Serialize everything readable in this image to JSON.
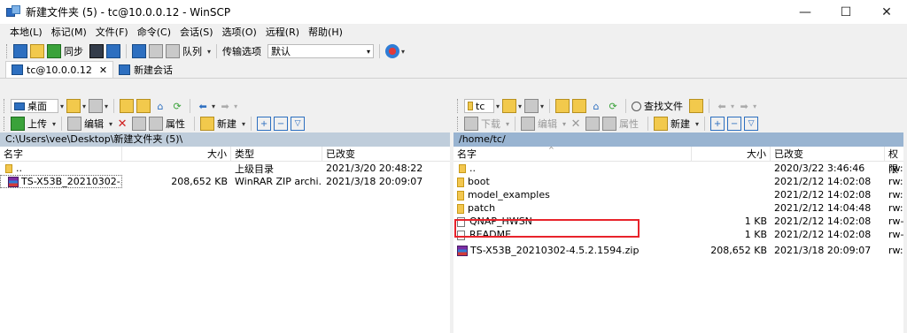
{
  "window": {
    "title": "新建文件夹 (5) - tc@10.0.0.12 - WinSCP",
    "minimize": "—",
    "maximize": "☐",
    "close": "✕"
  },
  "menu": [
    "本地(L)",
    "标记(M)",
    "文件(F)",
    "命令(C)",
    "会话(S)",
    "选项(O)",
    "远程(R)",
    "帮助(H)"
  ],
  "main_toolbar": {
    "sync_label": "同步",
    "queue_label": "队列",
    "transfer_label": "传输选项",
    "transfer_value": "默认"
  },
  "tabs": [
    {
      "label": "tc@10.0.0.12",
      "close": "✕"
    },
    {
      "label": "新建会话"
    }
  ],
  "left_panel": {
    "location": "桌面",
    "actions": {
      "upload": "上传",
      "edit": "编辑",
      "properties": "属性",
      "new": "新建"
    },
    "path": "C:\\Users\\vee\\Desktop\\新建文件夹 (5)\\",
    "columns": {
      "name": "名字",
      "size": "大小",
      "type": "类型",
      "modified": "已改变"
    },
    "rows": [
      {
        "name": "..",
        "size": "",
        "type": "上级目录",
        "modified": "2021/3/20  20:48:22",
        "icon": "parent-dir"
      },
      {
        "name": "TS-X53B_20210302-...",
        "size": "208,652 KB",
        "type": "WinRAR ZIP archi...",
        "modified": "2021/3/18  20:09:07",
        "icon": "rar-archive"
      }
    ]
  },
  "right_panel": {
    "location": "tc",
    "find_label": "查找文件",
    "actions": {
      "download": "下载",
      "edit": "编辑",
      "properties": "属性",
      "new": "新建"
    },
    "path": "/home/tc/",
    "columns": {
      "name": "名字",
      "size": "大小",
      "modified": "已改变",
      "rights": "权限"
    },
    "rows": [
      {
        "name": "..",
        "size": "",
        "modified": "2020/3/22 3:46:46",
        "rights": "rw:",
        "icon": "parent-dir"
      },
      {
        "name": "boot",
        "size": "",
        "modified": "2021/2/12 14:02:08",
        "rights": "rw:",
        "icon": "folder"
      },
      {
        "name": "model_examples",
        "size": "",
        "modified": "2021/2/12 14:02:08",
        "rights": "rw:",
        "icon": "folder"
      },
      {
        "name": "patch",
        "size": "",
        "modified": "2021/2/12 14:04:48",
        "rights": "rw:",
        "icon": "folder"
      },
      {
        "name": "QNAP_HWSN",
        "size": "1 KB",
        "modified": "2021/2/12 14:02:08",
        "rights": "rw-",
        "icon": "file"
      },
      {
        "name": "README",
        "size": "1 KB",
        "modified": "2021/2/12 14:02:08",
        "rights": "rw-",
        "icon": "file"
      },
      {
        "name": "TS-X53B_20210302-4.5.2.1594.zip",
        "size": "208,652 KB",
        "modified": "2021/3/18 20:09:07",
        "rights": "rw:",
        "icon": "rar-archive"
      }
    ]
  },
  "colors": {
    "highlight": "#e8232b",
    "active_path_bg": "#99b4d1",
    "inactive_path_bg": "#bfcddb"
  }
}
